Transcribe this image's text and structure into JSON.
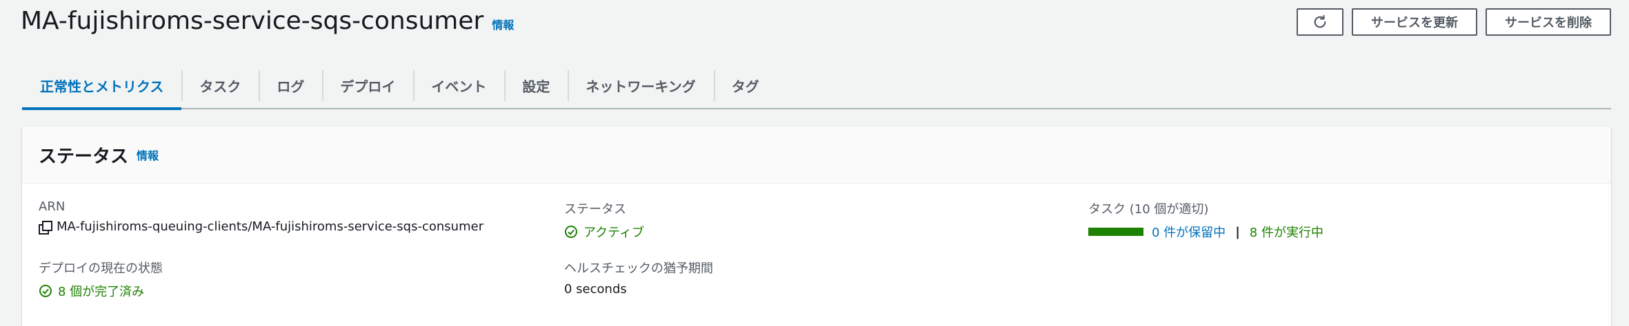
{
  "header": {
    "title": "MA-fujishiroms-service-sqs-consumer",
    "info": "情報",
    "actions": {
      "refresh_icon": "refresh-icon",
      "update": "サービスを更新",
      "delete": "サービスを削除"
    }
  },
  "tabs": [
    {
      "label": "正常性とメトリクス",
      "active": true
    },
    {
      "label": "タスク"
    },
    {
      "label": "ログ"
    },
    {
      "label": "デプロイ"
    },
    {
      "label": "イベント"
    },
    {
      "label": "設定"
    },
    {
      "label": "ネットワーキング"
    },
    {
      "label": "タグ"
    }
  ],
  "status_panel": {
    "title": "ステータス",
    "info": "情報",
    "arn": {
      "label": "ARN",
      "value": "MA-fujishiroms-queuing-clients/MA-fujishiroms-service-sqs-consumer"
    },
    "status": {
      "label": "ステータス",
      "value": "アクティブ"
    },
    "tasks": {
      "label": "タスク (10 個が適切)",
      "pending": "0 件が保留中",
      "separator": "|",
      "running": "8 件が実行中",
      "running_fraction": 0.8
    },
    "deployment": {
      "label": "デプロイの現在の状態",
      "value": "8 個が完了済み"
    },
    "health_check": {
      "label": "ヘルスチェックの猶予期間",
      "value": "0 seconds"
    }
  },
  "colors": {
    "accent": "#0073bb",
    "success": "#1d8102",
    "border": "#545b64"
  }
}
